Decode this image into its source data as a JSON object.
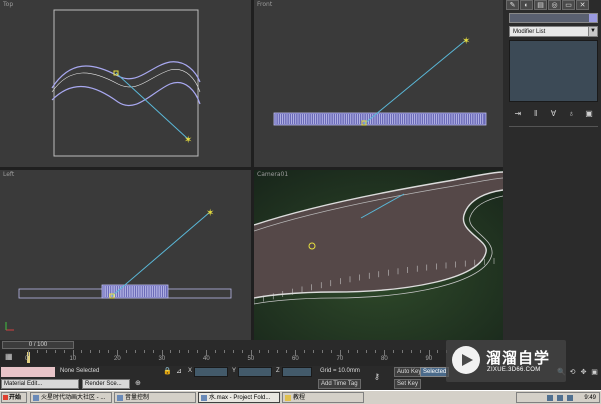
{
  "viewports": {
    "top": {
      "label": "Top"
    },
    "front": {
      "label": "Front"
    },
    "left": {
      "label": "Left"
    },
    "camera": {
      "label": "Camera01"
    }
  },
  "command_panel": {
    "tab_icons": [
      "create-icon",
      "modify-icon",
      "hierarchy-icon",
      "motion-icon",
      "display-icon",
      "utilities-icon"
    ],
    "modifier_list_label": "Modifier List",
    "object_color": "#9a9ae0"
  },
  "time_slider": {
    "frame_text": "0 / 100"
  },
  "track_bar": {
    "ticks": [
      "0",
      "10",
      "20",
      "30",
      "40",
      "50",
      "60",
      "70",
      "80",
      "90"
    ]
  },
  "status_bar": {
    "selection_text": "None Selected",
    "x_label": "X",
    "y_label": "Y",
    "z_label": "Z",
    "grid_text": "Grid = 10.0mm",
    "add_time_tag_label": "Add Time Tag",
    "auto_key_label": "Auto Key",
    "selected_label": "Selected",
    "set_key_label": "Set Key",
    "material_editor_label": "Material Edit...",
    "render_setup_label": "Render Sce..."
  },
  "watermark": {
    "title": "溜溜自学",
    "url": "ZIXUE.3D66.COM"
  },
  "taskbar": {
    "start_label": "开始",
    "items": [
      "火星时代动画大社区 - ...",
      "音量控制",
      "水.max - Project Fold...",
      "教程"
    ],
    "time": "9:49"
  },
  "colors": {
    "viewport_bg": "#3a3a3a",
    "selection": "#a8a8f0",
    "camera_line": "#5ab8d8",
    "star": "#e8e040"
  }
}
